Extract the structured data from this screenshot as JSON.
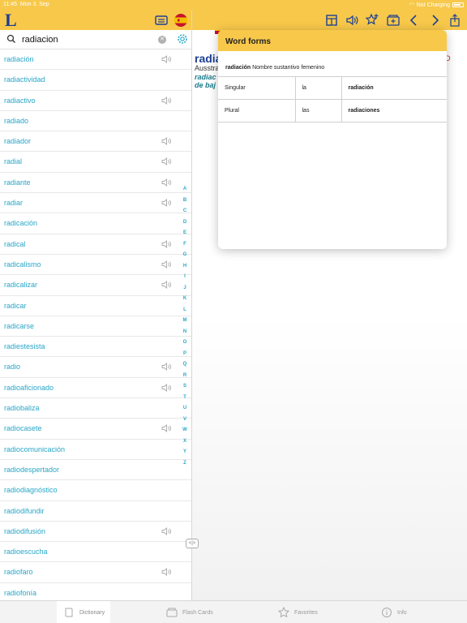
{
  "status": {
    "time": "11:45",
    "date": "Mon 3. Sep",
    "charging": "Not Charging"
  },
  "toolbar": {
    "logo": "L",
    "icons": [
      "keyboard-icon",
      "spanish-flag-icon",
      "word-forms-icon",
      "speaker-icon",
      "star-add-icon",
      "flashcard-add-icon",
      "back-chevron-icon",
      "forward-chevron-icon",
      "share-icon"
    ],
    "accent": "#f7c84a",
    "brand": "#1c3f94"
  },
  "search": {
    "value": "radiacion",
    "placeholder": ""
  },
  "list": [
    {
      "word": "radiación",
      "audio": true
    },
    {
      "word": "radiactividad",
      "audio": false
    },
    {
      "word": "radiactivo",
      "audio": true
    },
    {
      "word": "radiado",
      "audio": false
    },
    {
      "word": "radiador",
      "audio": true
    },
    {
      "word": "radial",
      "audio": true
    },
    {
      "word": "radiante",
      "audio": true
    },
    {
      "word": "radiar",
      "audio": true
    },
    {
      "word": "radicación",
      "audio": false
    },
    {
      "word": "radical",
      "audio": true
    },
    {
      "word": "radicalismo",
      "audio": true
    },
    {
      "word": "radicalizar",
      "audio": true
    },
    {
      "word": "radicar",
      "audio": false
    },
    {
      "word": "radicarse",
      "audio": false
    },
    {
      "word": "radiestesista",
      "audio": false
    },
    {
      "word": "radio",
      "audio": true
    },
    {
      "word": "radioaficionado",
      "audio": true
    },
    {
      "word": "radiobaliza",
      "audio": false
    },
    {
      "word": "radiocasete",
      "audio": true
    },
    {
      "word": "radiocomunicación",
      "audio": false
    },
    {
      "word": "radiodespertador",
      "audio": false
    },
    {
      "word": "radiodiagnóstico",
      "audio": false
    },
    {
      "word": "radiodifundir",
      "audio": false
    },
    {
      "word": "radiodifusión",
      "audio": true
    },
    {
      "word": "radioescucha",
      "audio": false
    },
    {
      "word": "radiofaro",
      "audio": true
    },
    {
      "word": "radiofonía",
      "audio": false
    }
  ],
  "alphabet": [
    "A",
    "B",
    "C",
    "D",
    "E",
    "F",
    "G",
    "H",
    "I",
    "J",
    "K",
    "L",
    "M",
    "N",
    "O",
    "P",
    "Q",
    "R",
    "S",
    "T",
    "U",
    "V",
    "W",
    "X",
    "Y",
    "Z"
  ],
  "entry": {
    "head": "radia",
    "right": "IO",
    "line2": "Ausstra",
    "line3": "radiac",
    "line4": "de baj"
  },
  "popover": {
    "title": "Word forms",
    "headword": "radiación",
    "pos": "Nombre sustantivo femenino",
    "rows": [
      {
        "number": "Singular",
        "article": "la",
        "form": "radiación"
      },
      {
        "number": "Plural",
        "article": "las",
        "form": "radiaciones"
      }
    ]
  },
  "splitter": "<|>",
  "tabs": [
    {
      "label": "Dictionary",
      "icon": "book-icon",
      "active": true
    },
    {
      "label": "Flash Cards",
      "icon": "flashcards-icon",
      "active": false
    },
    {
      "label": "Favorites",
      "icon": "star-icon",
      "active": false
    },
    {
      "label": "Info",
      "icon": "info-icon",
      "active": false
    }
  ]
}
